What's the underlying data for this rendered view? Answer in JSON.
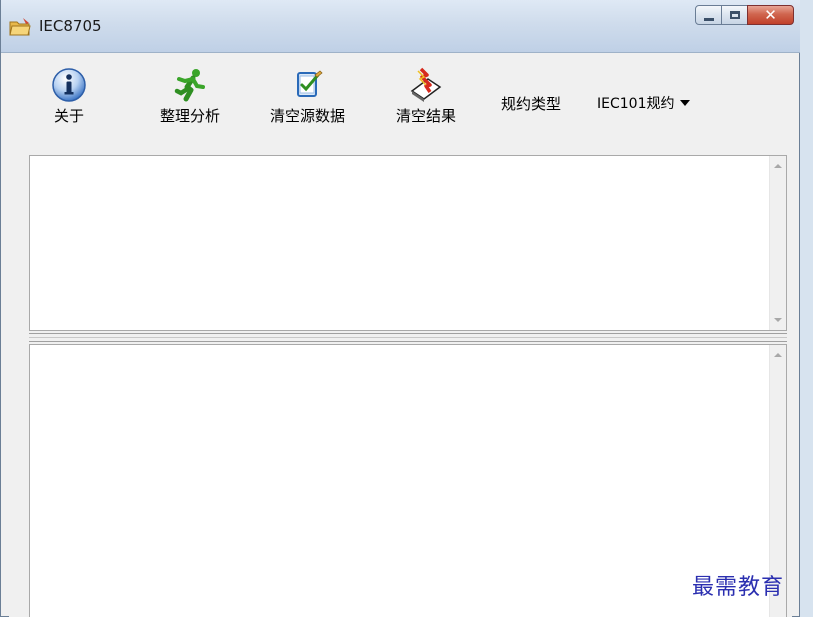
{
  "window": {
    "title": "IEC8705"
  },
  "toolbar": {
    "about_label": "关于",
    "analyze_label": "整理分析",
    "clear_source_label": "清空源数据",
    "clear_result_label": "清空结果",
    "protocol_type_label": "规约类型",
    "protocol_selected": "IEC101规约"
  },
  "icons": {
    "about": "info-icon",
    "analyze": "running-man-icon",
    "clear_source": "clipboard-check-icon",
    "clear_result": "eraser-lightning-icon"
  },
  "watermark": "最需教育",
  "colors": {
    "accent_close": "#c1402a",
    "watermark": "#2b2fb0"
  }
}
